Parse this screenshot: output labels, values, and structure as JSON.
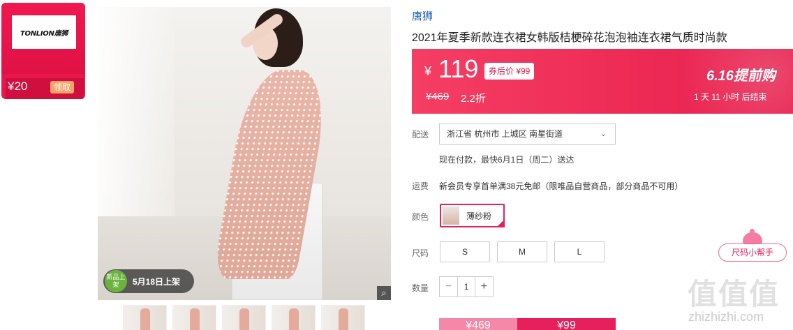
{
  "coupon": {
    "logo_text": "TONLION唐狮",
    "amount": "¥20",
    "claim_label": "领取"
  },
  "gallery": {
    "badge_circle": "新品上架",
    "badge_text": "5月18日上架",
    "zoom_icon": "zoom-icon",
    "thumbnail_count": 5
  },
  "product": {
    "brand": "唐狮",
    "title": "2021年夏季新款连衣裙女韩版桔梗碎花泡泡袖连衣裙气质时尚款"
  },
  "price": {
    "currency": "¥",
    "now": "119",
    "after_coupon": "券后价 ¥99",
    "original": "¥469",
    "discount": "2.2折",
    "promo_logo": "6.16提前购",
    "countdown": "1 天 11 小时 后结束"
  },
  "delivery": {
    "label": "配送",
    "address": "浙江省 杭州市 上城区 南星街道",
    "note": "现在付款，最快6月1日（周二）送达"
  },
  "shipping": {
    "label": "运费",
    "note": "新会员专享首单满38元免邮（限唯品自营商品，部分商品不可用）"
  },
  "color": {
    "label": "颜色",
    "selected": "薄纱粉"
  },
  "size": {
    "label": "尺码",
    "options": [
      "S",
      "M",
      "L"
    ],
    "helper": "尺码小帮手"
  },
  "quantity": {
    "label": "数量",
    "minus": "−",
    "value": "1",
    "plus": "+"
  },
  "buy": {
    "left_price": "¥469",
    "right_price": "¥99"
  },
  "watermark": {
    "logo": "值值值",
    "url": "zhizhizhi.com"
  }
}
